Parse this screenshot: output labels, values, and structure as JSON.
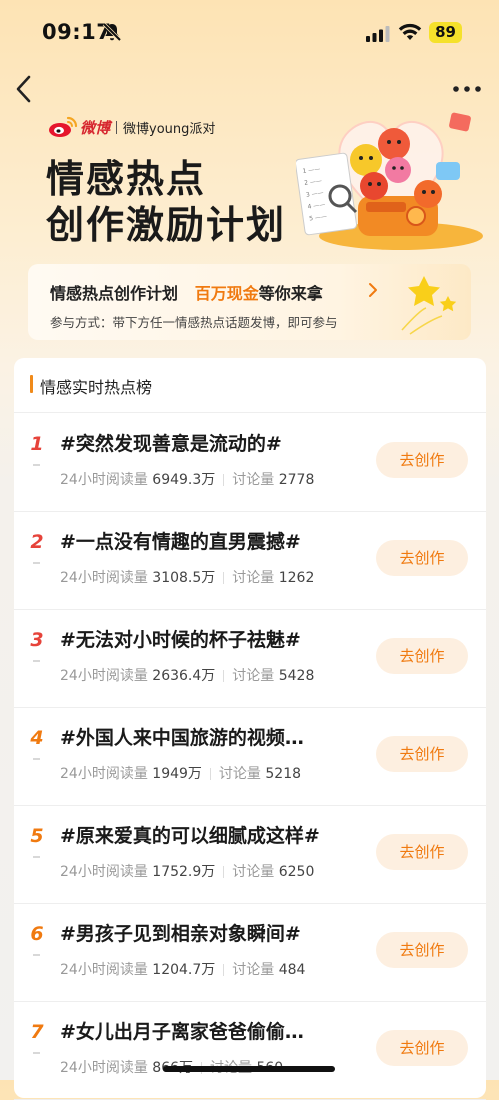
{
  "status": {
    "time": "09:17",
    "battery": "89"
  },
  "brand": {
    "name": "微博",
    "sub": "微博young派对"
  },
  "hero": {
    "title_line1": "情感热点",
    "title_line2": "创作激励计划"
  },
  "promo": {
    "line1_prefix": "情感热点创作计划",
    "line1_highlight": "百万现金",
    "line1_suffix": "等你来拿",
    "line2": "参与方式：带下方任一情感热点话题发博，即可参与"
  },
  "board": {
    "title": "情感实时热点榜",
    "read_label": "24小时阅读量",
    "discuss_label": "讨论量",
    "button_label": "去创作",
    "items": [
      {
        "rank": "1",
        "topic": "#突然发现善意是流动的#",
        "reads": "6949.3万",
        "discuss": "2778"
      },
      {
        "rank": "2",
        "topic": "#一点没有情趣的直男震撼#",
        "reads": "3108.5万",
        "discuss": "1262"
      },
      {
        "rank": "3",
        "topic": "#无法对小时候的杯子祛魅#",
        "reads": "2636.4万",
        "discuss": "5428"
      },
      {
        "rank": "4",
        "topic": "#外国人来中国旅游的视频…",
        "reads": "1949万",
        "discuss": "5218"
      },
      {
        "rank": "5",
        "topic": "#原来爱真的可以细腻成这样#",
        "reads": "1752.9万",
        "discuss": "6250"
      },
      {
        "rank": "6",
        "topic": "#男孩子见到相亲对象瞬间#",
        "reads": "1204.7万",
        "discuss": "484"
      },
      {
        "rank": "7",
        "topic": "#女儿出月子离家爸爸偷偷…",
        "reads": "866万",
        "discuss": "560"
      }
    ]
  },
  "colors": {
    "accent": "#f07a10",
    "rank_top": "#e6433a",
    "brand_red": "#d6262f"
  }
}
